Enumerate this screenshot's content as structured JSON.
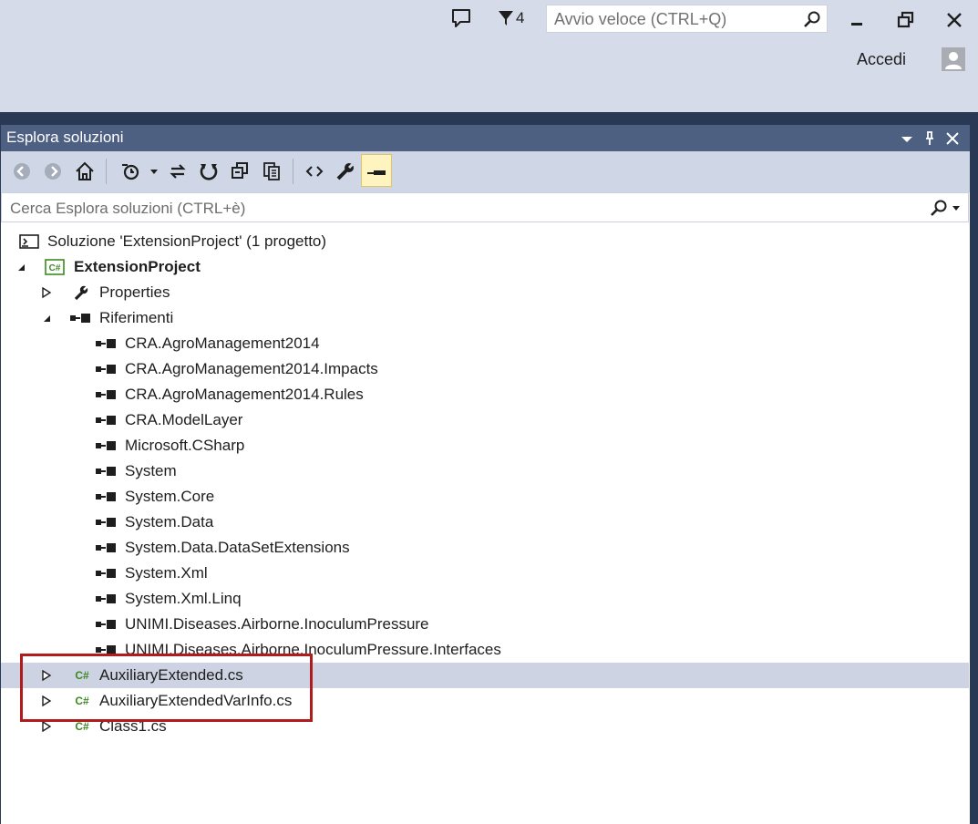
{
  "titlebar": {
    "notifications_count": "4",
    "quick_launch_placeholder": "Avvio veloce (CTRL+Q)",
    "sign_in_label": "Accedi"
  },
  "solution_explorer": {
    "title": "Esplora soluzioni",
    "search_placeholder": "Cerca Esplora soluzioni (CTRL+è)",
    "toolbar_icons": [
      "back-icon",
      "forward-icon",
      "home-icon",
      "pending-changes-icon",
      "dropdown-icon",
      "sync-icon",
      "refresh-icon",
      "collapse-all-icon",
      "copy-icon",
      "view-code-icon",
      "properties-icon",
      "preview-icon"
    ],
    "tree": {
      "solution": {
        "label": "Soluzione 'ExtensionProject'  (1 progetto)"
      },
      "project": {
        "label": "ExtensionProject",
        "icon": "csharp-project-icon"
      },
      "properties": {
        "label": "Properties"
      },
      "references": {
        "label": "Riferimenti",
        "items": [
          "CRA.AgroManagement2014",
          "CRA.AgroManagement2014.Impacts",
          "CRA.AgroManagement2014.Rules",
          "CRA.ModelLayer",
          "Microsoft.CSharp",
          "System",
          "System.Core",
          "System.Data",
          "System.Data.DataSetExtensions",
          "System.Xml",
          "System.Xml.Linq",
          "UNIMI.Diseases.Airborne.InoculumPressure",
          "UNIMI.Diseases.Airborne.InoculumPressure.Interfaces"
        ]
      },
      "files": [
        {
          "label": "AuxiliaryExtended.cs",
          "selected": true
        },
        {
          "label": "AuxiliaryExtendedVarInfo.cs",
          "selected": false
        },
        {
          "label": "Class1.cs",
          "selected": false
        }
      ]
    }
  },
  "colors": {
    "header": "#4d6082",
    "toolbar": "#cfd6e5",
    "selection": "#cdd3e2",
    "highlight_border": "#b01c1c",
    "csharp_green": "#3c8a1f"
  }
}
